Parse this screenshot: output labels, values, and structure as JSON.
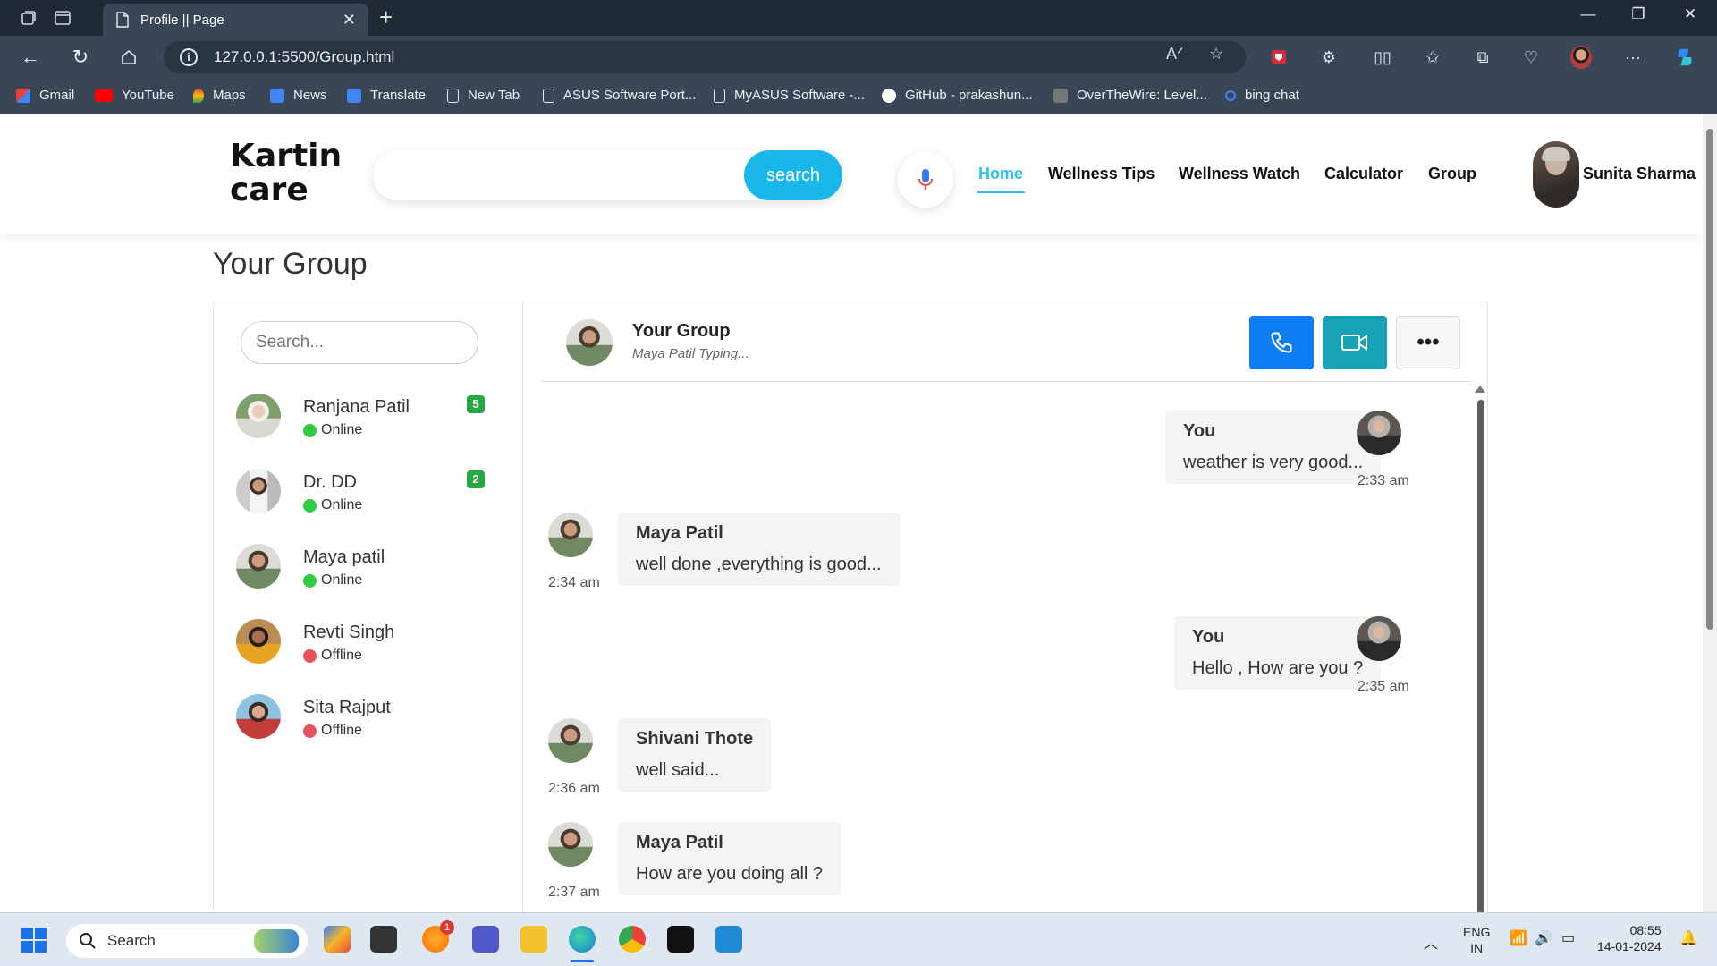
{
  "browser": {
    "tab_title": "Profile || Page",
    "url": "127.0.0.1:5500/Group.html",
    "bookmarks": [
      {
        "label": "Gmail",
        "color": "#ea4335"
      },
      {
        "label": "YouTube",
        "color": "#ff0000"
      },
      {
        "label": "Maps",
        "color": "#34a853"
      },
      {
        "label": "News",
        "color": "#4285f4"
      },
      {
        "label": "Translate",
        "color": "#4285f4"
      },
      {
        "label": "New Tab",
        "color": "none"
      },
      {
        "label": "ASUS Software Port...",
        "color": "none"
      },
      {
        "label": "MyASUS Software -...",
        "color": "none"
      },
      {
        "label": "GitHub - prakashun...",
        "color": "#ffffff"
      },
      {
        "label": "OverTheWire: Level...",
        "color": "#888888"
      },
      {
        "label": "bing chat",
        "color": "#3b82f6"
      }
    ]
  },
  "site": {
    "logo_line1": "Kartin",
    "logo_line2": "care",
    "search_button": "search",
    "nav": [
      {
        "label": "Home",
        "active": true
      },
      {
        "label": "Wellness Tips",
        "active": false
      },
      {
        "label": "Wellness Watch",
        "active": false
      },
      {
        "label": "Calculator",
        "active": false
      },
      {
        "label": "Group",
        "active": false
      }
    ],
    "user_name": "Sunita Sharma",
    "accent_color": "#2cc0ea"
  },
  "page": {
    "title": "Your Group",
    "search_placeholder": "Search..."
  },
  "contacts": [
    {
      "name": "Ranjana Patil",
      "status": "Online",
      "unread": "5"
    },
    {
      "name": "Dr. DD",
      "status": "Online",
      "unread": "2"
    },
    {
      "name": "Maya patil",
      "status": "Online",
      "unread": ""
    },
    {
      "name": "Revti Singh",
      "status": "Offline",
      "unread": ""
    },
    {
      "name": "Sita Rajput",
      "status": "Offline",
      "unread": ""
    }
  ],
  "chat": {
    "title": "Your Group",
    "typing": "Maya Patil Typing...",
    "more_label": "•••",
    "messages": [
      {
        "sender": "You",
        "text": "weather is very good...",
        "time": "2:33 am",
        "outgoing": true
      },
      {
        "sender": "Maya Patil",
        "text": "well done ,everything is good...",
        "time": "2:34 am",
        "outgoing": false
      },
      {
        "sender": "You",
        "text": "Hello , How are you ?",
        "time": "2:35 am",
        "outgoing": true
      },
      {
        "sender": "Shivani Thote",
        "text": "well said...",
        "time": "2:36 am",
        "outgoing": false
      },
      {
        "sender": "Maya Patil",
        "text": "How are you doing all ?",
        "time": "2:37 am",
        "outgoing": false
      }
    ]
  },
  "taskbar": {
    "search_label": "Search",
    "lang_line1": "ENG",
    "lang_line2": "IN",
    "time": "08:55",
    "date": "14-01-2024",
    "notification_count": "1"
  }
}
